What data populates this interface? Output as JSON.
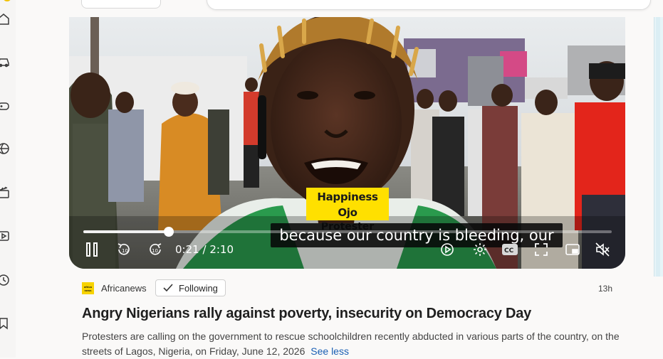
{
  "icons": {
    "rail": [
      "home-icon",
      "car-icon",
      "gamepad-icon",
      "sports-icon",
      "clapper-icon",
      "video-icon",
      "history-icon",
      "bookmark-icon"
    ],
    "player": [
      "pause-icon",
      "rewind-10-icon",
      "forward-10-icon",
      "play-circle-icon",
      "settings-icon",
      "captions-icon",
      "fullscreen-icon",
      "picture-in-picture-icon",
      "mute-icon"
    ]
  },
  "video": {
    "lower_third_name": "Happiness Ojo",
    "lower_third_role": "Protester",
    "caption": "because our country is bleeding, our",
    "time_current": "0:21",
    "time_sep": "/",
    "time_total": "2:10",
    "progress": 0.162,
    "cc_label": "CC"
  },
  "article": {
    "source_logo_text": "africa news",
    "source": "Africanews",
    "follow_label": "Following",
    "age": "13h",
    "title": "Angry Nigerians rally against poverty, insecurity on Democracy Day",
    "summary": "Protesters are calling on the government to rescue schoolchildren recently abducted in various parts of the country, on the streets of Lagos, Nigeria, on Friday, June 12, 2026",
    "see_less": "See less"
  },
  "colors": {
    "lower_third_bg": "#ffe000",
    "source_logo_bg": "#f7d300",
    "link": "#1a5fb4"
  }
}
